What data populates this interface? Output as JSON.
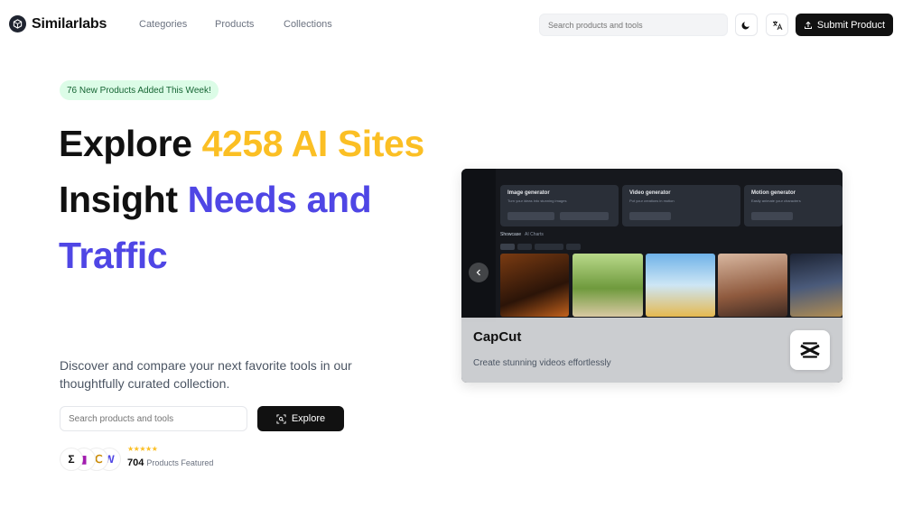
{
  "nav": {
    "brand": "Similarlabs",
    "links": [
      "Categories",
      "Products",
      "Collections"
    ],
    "search_placeholder": "Search products and tools",
    "theme_icon": "moon-icon",
    "language_icon": "translate-icon",
    "submit_label": "Submit Product"
  },
  "hero": {
    "badge": "76 New Products Added This Week!",
    "headline": {
      "part1": "Explore ",
      "highlight1": "4258 AI Sites",
      "part2": "Insight ",
      "highlight2": "Needs and Traffic"
    },
    "subtitle": "Discover and compare your next favorite tools in our thoughtfully curated collection.",
    "search_placeholder": "Search products and tools",
    "explore_label": "Explore",
    "rating": "★★★★★",
    "featured_count": "704",
    "featured_label": "Products Featured",
    "avatar_glyphs": [
      "Σ",
      "▮",
      "℃",
      "W"
    ]
  },
  "showcase": {
    "app_name": "CapCut",
    "app_desc": "Create stunning videos effortlessly",
    "cards": [
      {
        "title": "Image generator",
        "subtitle": "Turn your ideas into stunning images"
      },
      {
        "title": "Video generator",
        "subtitle": "Put your creations in motion"
      },
      {
        "title": "Motion generator",
        "subtitle": "Easily animate your characters"
      }
    ],
    "tabs": [
      "Showcase",
      "AI Charts"
    ]
  },
  "colors": {
    "accent_yellow": "#fbbf24",
    "accent_purple": "#4f46e5",
    "badge_bg": "#dcfce7",
    "badge_text": "#166534",
    "dark": "#111111"
  }
}
